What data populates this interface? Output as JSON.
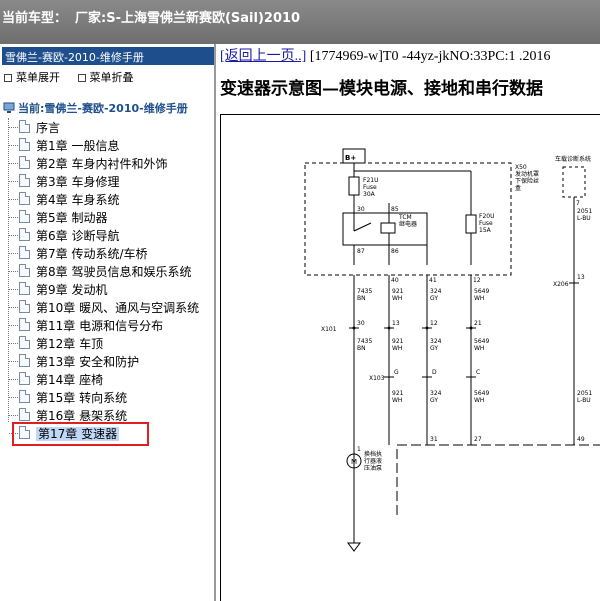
{
  "window": {
    "title_label": "当前车型：",
    "title_value": "厂家:S-上海雪佛兰新赛欧(Sail)2010"
  },
  "sidebar": {
    "book_title": "雪佛兰-赛欧-2010-维修手册",
    "expand_label": "菜单展开",
    "collapse_label": "菜单折叠",
    "root_label": "当前:雪佛兰-赛欧-2010-维修手册",
    "items": [
      {
        "label": "序言"
      },
      {
        "label": "第1章 一般信息"
      },
      {
        "label": "第2章 车身内衬件和外饰"
      },
      {
        "label": "第3章 车身修理"
      },
      {
        "label": "第4章 车身系统"
      },
      {
        "label": "第5章 制动器"
      },
      {
        "label": "第6章 诊断导航"
      },
      {
        "label": "第7章 传动系统/车桥"
      },
      {
        "label": "第8章 驾驶员信息和娱乐系统"
      },
      {
        "label": "第9章 发动机"
      },
      {
        "label": "第10章 暖风、通风与空调系统"
      },
      {
        "label": "第11章 电源和信号分布"
      },
      {
        "label": "第12章 车顶"
      },
      {
        "label": "第13章 安全和防护"
      },
      {
        "label": "第14章 座椅"
      },
      {
        "label": "第15章 转向系统"
      },
      {
        "label": "第16章 悬架系统"
      },
      {
        "label": "第17章 变速器"
      }
    ]
  },
  "content": {
    "back_link": "[返回上一页..]",
    "doc_ref": " [1774969-w]T0 -44yz-jkNO:33PC:1 .2016",
    "title": "变速器示意图—模块电源、接地和串行数据"
  },
  "diagram": {
    "battery": "B+",
    "fuse1_name": "F21U",
    "fuse1_type": "Fuse",
    "fuse1_amp": "30A",
    "fuse2_name": "F20U",
    "fuse2_type": "Fuse",
    "fuse2_amp": "15A",
    "x50_id": "X50",
    "x50_line1": "发动机罩",
    "x50_line2": "下保险丝",
    "x50_line3": "盒",
    "relay_label1": "TCM",
    "relay_label2": "继电器",
    "diag_label": "车载诊断系统",
    "pin_30": "30",
    "pin_85": "85",
    "pin_87": "87",
    "pin_86": "86",
    "pin_40": "40",
    "pin_41": "41",
    "pin_12": "12",
    "pin_7": "7",
    "c1_a": "7435",
    "c1_b": "BN",
    "c2_a": "921",
    "c2_b": "WH",
    "c3_a": "324",
    "c3_b": "GY",
    "c4_a": "5649",
    "c4_b": "WH",
    "c5_a": "2051",
    "c5_b": "L-BU",
    "x101": "X101",
    "x101_p30": "30",
    "x101_p13": "13",
    "x101_p12": "12",
    "x101_p21": "21",
    "x206": "X206",
    "x206_p13": "13",
    "x103": "X103",
    "x103_g": "G",
    "x103_d": "D",
    "x103_c": "C",
    "pin_31": "31",
    "pin_27": "27",
    "pin_49": "49",
    "pin_1": "1",
    "motor": "M",
    "motor_line1": "换档执",
    "motor_line2": "行器液",
    "motor_line3": "压油泵"
  }
}
